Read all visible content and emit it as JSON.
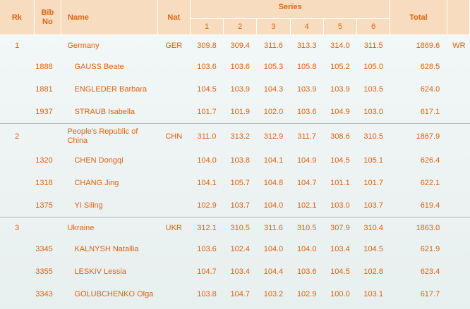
{
  "headers": {
    "rk": "Rk",
    "bib": "Bib\nNo",
    "name": "Name",
    "nat": "Nat",
    "series": "Series",
    "total": "Total",
    "series_numbers": [
      "1",
      "2",
      "3",
      "4",
      "5",
      "6"
    ]
  },
  "rows": [
    {
      "type": "team",
      "rk": "1",
      "bib": "",
      "name": "Germany",
      "nat": "GER",
      "series": [
        "309.8",
        "309.4",
        "311.6",
        "313.3",
        "314.0",
        "311.5"
      ],
      "total": "1869.6",
      "note": "WR"
    },
    {
      "type": "athlete",
      "rk": "",
      "bib": "1888",
      "name": "GAUSS Beate",
      "nat": "",
      "series": [
        "103.6",
        "103.6",
        "105.3",
        "105.8",
        "105.2",
        "105.0"
      ],
      "total": "628.5",
      "note": ""
    },
    {
      "type": "athlete",
      "rk": "",
      "bib": "1881",
      "name": "ENGLEDER Barbara",
      "nat": "",
      "series": [
        "104.5",
        "103.9",
        "104.3",
        "103.9",
        "103.9",
        "103.5"
      ],
      "total": "624.0",
      "note": ""
    },
    {
      "type": "athlete",
      "rk": "",
      "bib": "1937",
      "name": "STRAUB Isabella",
      "nat": "",
      "series": [
        "101.7",
        "101.9",
        "102.0",
        "103.6",
        "104.9",
        "103.0"
      ],
      "total": "617.1",
      "note": ""
    },
    {
      "type": "team",
      "rk": "2",
      "bib": "",
      "name": "People's Republic of China",
      "nat": "CHN",
      "series": [
        "311.0",
        "313.2",
        "312.9",
        "311.7",
        "308.6",
        "310.5"
      ],
      "total": "1867.9",
      "note": ""
    },
    {
      "type": "athlete",
      "rk": "",
      "bib": "1320",
      "name": "CHEN Dongqi",
      "nat": "",
      "series": [
        "104.0",
        "103.8",
        "104.1",
        "104.9",
        "104.5",
        "105.1"
      ],
      "total": "626.4",
      "note": ""
    },
    {
      "type": "athlete",
      "rk": "",
      "bib": "1318",
      "name": "CHANG Jing",
      "nat": "",
      "series": [
        "104.1",
        "105.7",
        "104.8",
        "104.7",
        "101.1",
        "101.7"
      ],
      "total": "622.1",
      "note": ""
    },
    {
      "type": "athlete",
      "rk": "",
      "bib": "1375",
      "name": "YI Siling",
      "nat": "",
      "series": [
        "102.9",
        "103.7",
        "104.0",
        "102.1",
        "103.0",
        "103.7"
      ],
      "total": "619.4",
      "note": ""
    },
    {
      "type": "team",
      "rk": "3",
      "bib": "",
      "name": "Ukraine",
      "nat": "UKR",
      "series": [
        "312.1",
        "310.5",
        "311.6",
        "310.5",
        "307.9",
        "310.4"
      ],
      "total": "1863.0",
      "note": ""
    },
    {
      "type": "athlete",
      "rk": "",
      "bib": "3345",
      "name": "KALNYSH Natallia",
      "nat": "",
      "series": [
        "103.6",
        "102.4",
        "104.0",
        "104.0",
        "103.4",
        "104.5"
      ],
      "total": "621.9",
      "note": ""
    },
    {
      "type": "athlete",
      "rk": "",
      "bib": "3355",
      "name": "LESKIV Lessia",
      "nat": "",
      "series": [
        "104.7",
        "103.4",
        "104.4",
        "103.6",
        "104.5",
        "102.8"
      ],
      "total": "623.4",
      "note": ""
    },
    {
      "type": "athlete",
      "rk": "",
      "bib": "3343",
      "name": "GOLUBCHENKO Olga",
      "nat": "",
      "series": [
        "103.8",
        "104.7",
        "103.2",
        "102.9",
        "100.0",
        "103.1"
      ],
      "total": "617.7",
      "note": ""
    }
  ]
}
